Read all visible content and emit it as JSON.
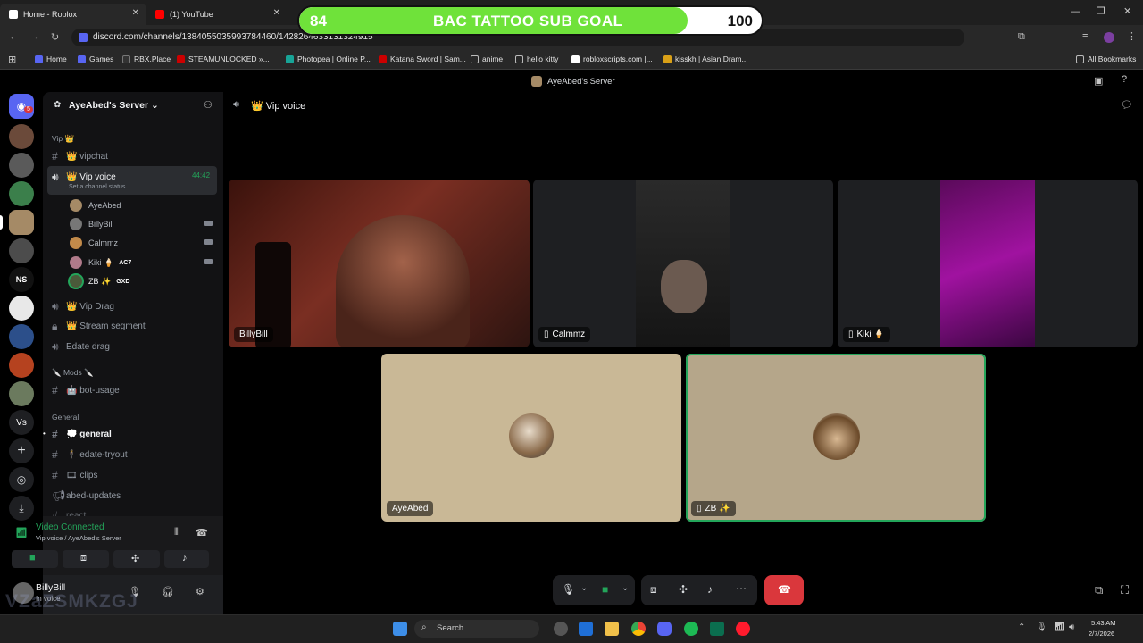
{
  "browser": {
    "tabs": [
      {
        "title": "Home - Roblox"
      },
      {
        "title": "(1) YouTube"
      }
    ],
    "url": "discord.com/channels/1384055035993784460/1428264633131324915",
    "bookmarks": [
      "Home",
      "Games",
      "RBX.Place",
      "STEAMUNLOCKED »...",
      "Photopea | Online P...",
      "Katana Sword | Sam...",
      "anime",
      "hello kitty",
      "robloxscripts.com |...",
      "kisskh | Asian Dram..."
    ],
    "all_bookmarks": "All Bookmarks"
  },
  "sub_goal": {
    "current": "84",
    "title": "BAC TATTOO SUB GOAL",
    "target": "100",
    "progress": 0.84
  },
  "discord": {
    "window_title": "AyeAbed's Server",
    "notification_count": "5",
    "server_name": "AyeAbed's Server",
    "categories": {
      "vip": "Vip 👑",
      "mods": "🔪 Mods 🔪",
      "general": "General"
    },
    "channels": {
      "vipchat": "👑 vipchat",
      "vip_voice": "👑 Vip voice",
      "vip_voice_time": "44:42",
      "channel_status": "Set a channel status",
      "vip_drag": "👑 Vip Drag",
      "stream_segment": "👑 Stream segment",
      "edate_drag": "Edate drag",
      "bot_usage": "🤖 bot-usage",
      "general": "💭 general",
      "edate_tryout": "🕴 edate-tryout",
      "clips": "🎞 clips",
      "abed_updates": "abed-updates",
      "react": "react"
    },
    "voice_users": [
      {
        "name": "AyeAbed",
        "tag": ""
      },
      {
        "name": "BillyBill",
        "tag": ""
      },
      {
        "name": "Calmmz",
        "tag": ""
      },
      {
        "name": "Kiki 🍦",
        "tag": "AC7"
      },
      {
        "name": "ZB ✨",
        "tag": "GXD"
      }
    ],
    "voice_panel": {
      "status": "Video Connected",
      "location": "Vip voice / AyeAbed's Server"
    },
    "account": {
      "name": "BillyBill",
      "status": "In voice"
    },
    "stage_header": "👑 Vip voice",
    "tiles": {
      "billybill": "BillyBill",
      "calmmz": "Calmmz",
      "kiki": "Kiki 🍦",
      "ayeabed": "AyeAbed",
      "zb": "ZB ✨"
    }
  },
  "watermark": "VZaZSMKZGJ",
  "taskbar": {
    "search": "Search",
    "time": "5:43 AM",
    "date": "2/7/2026"
  },
  "colors": {
    "goal_fill": "#6fe23a",
    "online": "#23a55a",
    "hangup": "#da373c",
    "tile_beige": "#c9b896"
  }
}
